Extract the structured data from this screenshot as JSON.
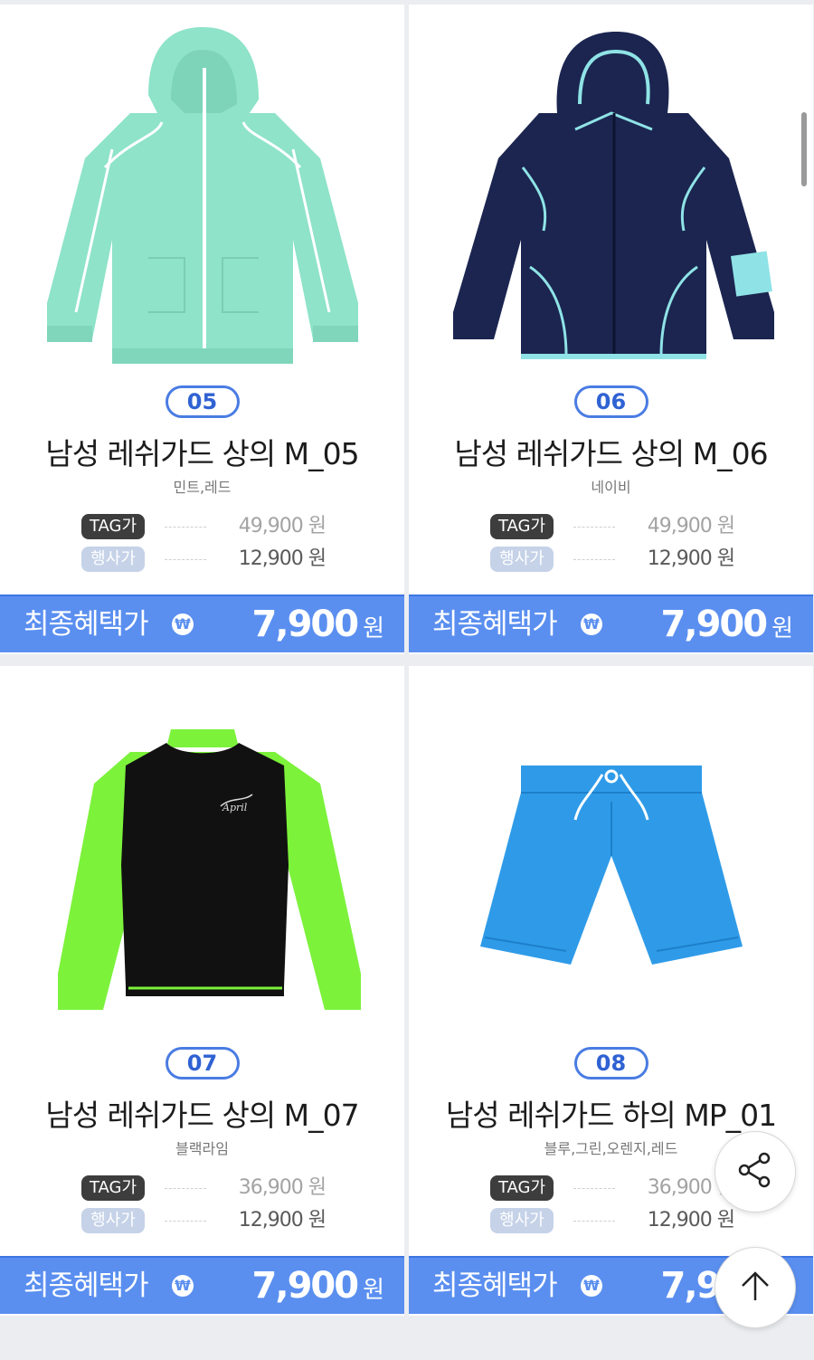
{
  "products": [
    {
      "number": "05",
      "name": "남성 레쉬가드 상의 M_05",
      "colors": "민트,레드",
      "tag_label": "TAG가",
      "tag_price": "49,900 원",
      "event_label": "행사가",
      "event_price": "12,900 원",
      "final_label": "최종혜택가",
      "final_price": "7,900",
      "final_unit": "원",
      "image": "mint-zip-hoodie"
    },
    {
      "number": "06",
      "name": "남성 레쉬가드 상의 M_06",
      "colors": "네이비",
      "tag_label": "TAG가",
      "tag_price": "49,900 원",
      "event_label": "행사가",
      "event_price": "12,900 원",
      "final_label": "최종혜택가",
      "final_price": "7,900",
      "final_unit": "원",
      "image": "navy-zip-hoodie"
    },
    {
      "number": "07",
      "name": "남성 레쉬가드 상의 M_07",
      "colors": "블랙라임",
      "tag_label": "TAG가",
      "tag_price": "36,900 원",
      "event_label": "행사가",
      "event_price": "12,900 원",
      "final_label": "최종혜택가",
      "final_price": "7,900",
      "final_unit": "원",
      "image": "black-lime-long-sleeve"
    },
    {
      "number": "08",
      "name": "남성 레쉬가드 하의 MP_01",
      "colors": "블루,그린,오렌지,레드",
      "tag_label": "TAG가",
      "tag_price": "36,900 원",
      "event_label": "행사가",
      "event_price": "12,900 원",
      "final_label": "최종혜택가",
      "final_price": "7,900",
      "final_unit": "원",
      "image": "blue-swim-shorts"
    }
  ],
  "won_symbol": "₩",
  "buttons": {
    "share_icon": "share-icon",
    "top_icon": "arrow-up-icon"
  },
  "colors": {
    "accent_blue": "#5a8ff0",
    "badge_blue": "#4a7ce3",
    "mint": "#8ee3c8",
    "navy": "#1b2550",
    "lime": "#7cf23b",
    "shorts_blue": "#2f9be8"
  }
}
